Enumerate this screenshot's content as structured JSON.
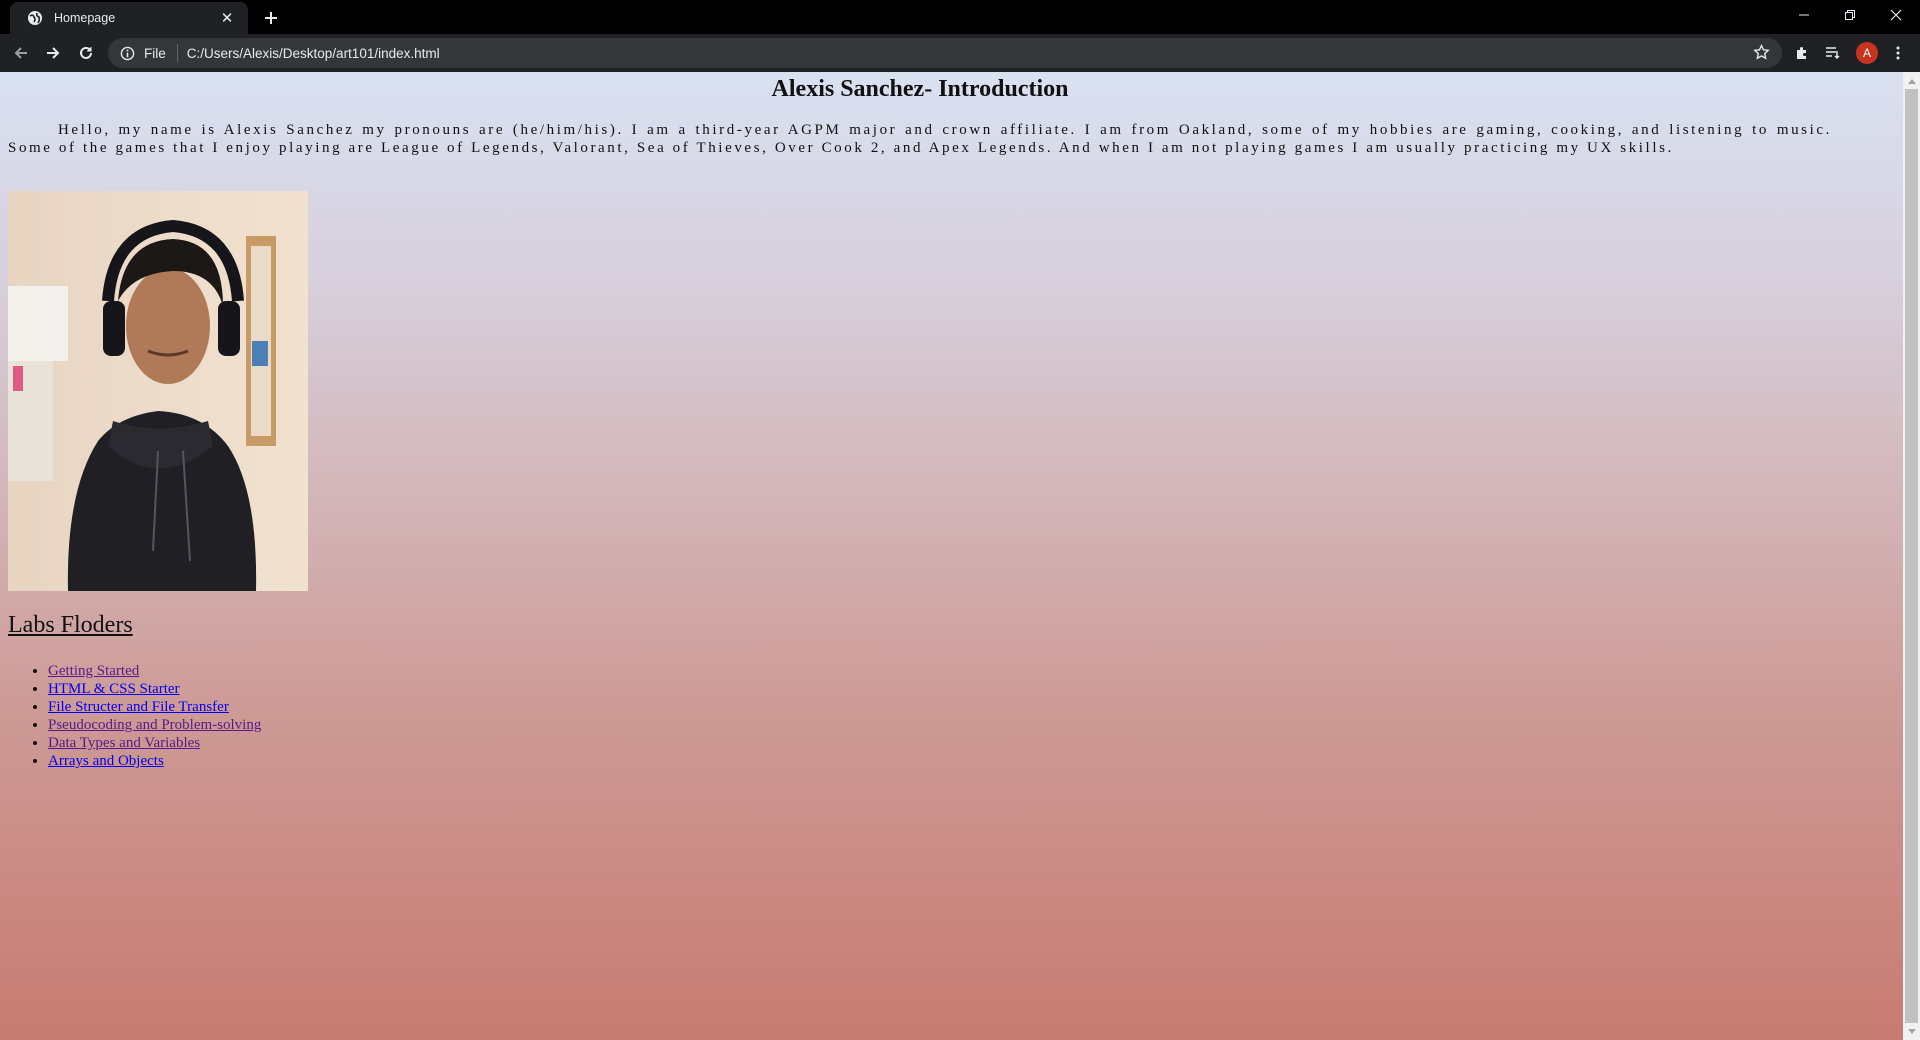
{
  "browser": {
    "tab_title": "Homepage",
    "url_chip": "File",
    "url": "C:/Users/Alexis/Desktop/art101/index.html",
    "profile_initial": "A",
    "profile_color": "#c5351f"
  },
  "page": {
    "title": "Alexis Sanchez- Introduction",
    "intro": "Hello, my name is Alexis Sanchez my pronouns are (he/him/his). I am a third-year AGPM major and crown affiliate. I am from Oakland, some of my hobbies are gaming, cooking, and listening to music. Some of the games that I enjoy playing are League of Legends, Valorant, Sea of Thieves, Over Cook 2, and Apex Legends. And when I am not playing games I am usually practicing my UX skills.",
    "labs_heading": "Labs Floders",
    "labs": [
      {
        "label": "Getting Started",
        "visited": true
      },
      {
        "label": "HTML & CSS Starter",
        "visited": false
      },
      {
        "label": "File Structer and File Transfer",
        "visited": false
      },
      {
        "label": "Pseudocoding and Problem-solving",
        "visited": true
      },
      {
        "label": "Data Types and Variables",
        "visited": true
      },
      {
        "label": "Arrays and Objects",
        "visited": false
      }
    ]
  },
  "colors": {
    "link_unvisited": "#0000ee",
    "link_visited": "#551a8b",
    "gradient_top": "#d9e1f1",
    "gradient_bottom": "#c77b71"
  }
}
